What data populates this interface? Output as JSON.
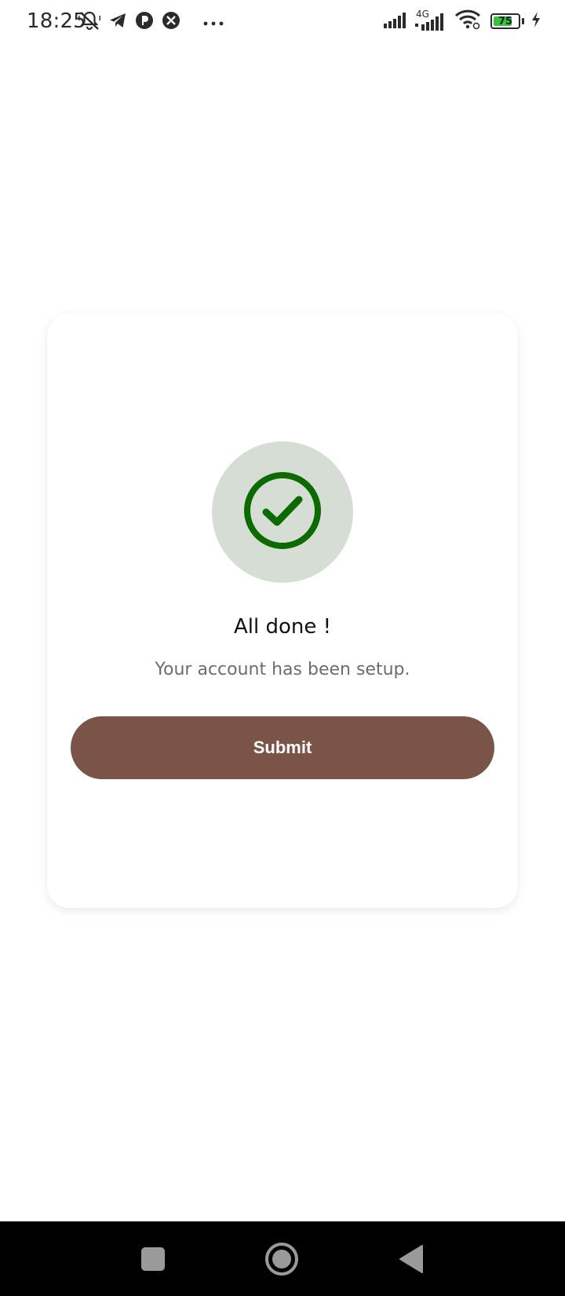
{
  "status_bar": {
    "time": "18:25",
    "network_type": "4G",
    "battery_level": "75",
    "battery_fraction": 0.75,
    "icons": [
      "bell-off-icon",
      "telegram-icon",
      "app-icon",
      "app-icon-2",
      "more-dots-icon",
      "signal-icon",
      "signal-4g-icon",
      "wifi-icon",
      "battery-icon",
      "charging-icon"
    ]
  },
  "card": {
    "icon": "check-circle-icon",
    "title": "All done !",
    "subtitle": "Your account has been setup.",
    "submit_label": "Submit"
  },
  "colors": {
    "accent_button": "#7a5447",
    "check_green": "#0b6b00",
    "check_bg": "#d5ddd4"
  },
  "nav_bar": {
    "icons": [
      "recents-icon",
      "home-icon",
      "back-icon"
    ]
  }
}
